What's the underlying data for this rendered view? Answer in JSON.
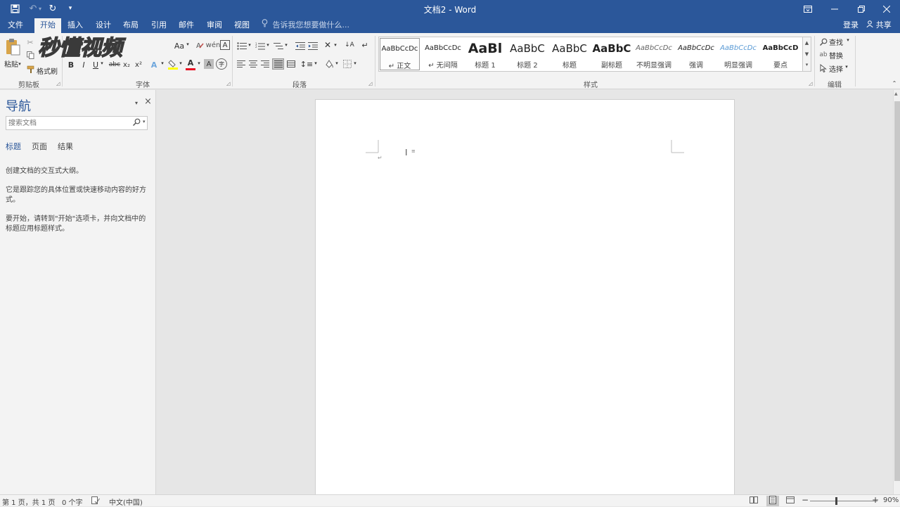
{
  "window": {
    "title": "文档2 - Word",
    "controls": [
      "ribbon-display-options",
      "minimize",
      "restore",
      "close"
    ]
  },
  "tabs": [
    {
      "label": "文件",
      "active": false
    },
    {
      "label": "开始",
      "active": true
    },
    {
      "label": "插入",
      "active": false
    },
    {
      "label": "设计",
      "active": false
    },
    {
      "label": "布局",
      "active": false
    },
    {
      "label": "引用",
      "active": false
    },
    {
      "label": "邮件",
      "active": false
    },
    {
      "label": "审阅",
      "active": false
    },
    {
      "label": "视图",
      "active": false
    }
  ],
  "tell_me": "告诉我您想要做什么...",
  "account": {
    "sign_in": "登录",
    "share": "共享"
  },
  "ribbon": {
    "clipboard": {
      "paste": "粘贴",
      "format_painter": "格式刷",
      "group": "剪贴板"
    },
    "font": {
      "group": "字体",
      "grow_shrink": "Aa",
      "bold": "B",
      "italic": "I",
      "underline": "U",
      "strike": "abc",
      "subscript": "x₂",
      "superscript": "x²",
      "text_effects": "A",
      "font_color": "A",
      "char_shading": "A",
      "enclose": "字"
    },
    "paragraph": {
      "group": "段落"
    },
    "styles": {
      "group": "样式",
      "items": [
        {
          "preview": "AaBbCcDc",
          "name": "↵ 正文",
          "selected": true
        },
        {
          "preview": "AaBbCcDc",
          "name": "↵ 无间隔",
          "selected": false
        },
        {
          "preview": "AaBl",
          "name": "标题 1",
          "selected": false
        },
        {
          "preview": "AaBbC",
          "name": "标题 2",
          "selected": false
        },
        {
          "preview": "AaBbC",
          "name": "标题",
          "selected": false
        },
        {
          "preview": "AaBbC",
          "name": "副标题",
          "selected": false
        },
        {
          "preview": "AaBbCcDc",
          "name": "不明显强调",
          "selected": false
        },
        {
          "preview": "AaBbCcDc",
          "name": "强调",
          "selected": false
        },
        {
          "preview": "AaBbCcDc",
          "name": "明显强调",
          "selected": false
        },
        {
          "preview": "AaBbCcD",
          "name": "要点",
          "selected": false
        }
      ]
    },
    "editing": {
      "find": "查找",
      "replace": "替换",
      "select": "选择",
      "group": "编辑"
    }
  },
  "nav_pane": {
    "title": "导航",
    "search_placeholder": "搜索文档",
    "tabs": [
      {
        "label": "标题",
        "active": true
      },
      {
        "label": "页面",
        "active": false
      },
      {
        "label": "结果",
        "active": false
      }
    ],
    "paragraphs": [
      "创建文档的交互式大纲。",
      "它是跟踪您的具体位置或快速移动内容的好方式。",
      "要开始，请转到\"开始\"选项卡，并向文档中的标题应用标题样式。"
    ]
  },
  "status": {
    "page": "第 1 页，共 1 页",
    "words": "0 个字",
    "language": "中文(中国)",
    "zoom": "90%"
  },
  "watermark": {
    "text": "秒懂视频"
  },
  "colors": {
    "accent": "#2b579a",
    "font_color_bar": "#e81123",
    "highlight_bar": "#ffff00"
  }
}
